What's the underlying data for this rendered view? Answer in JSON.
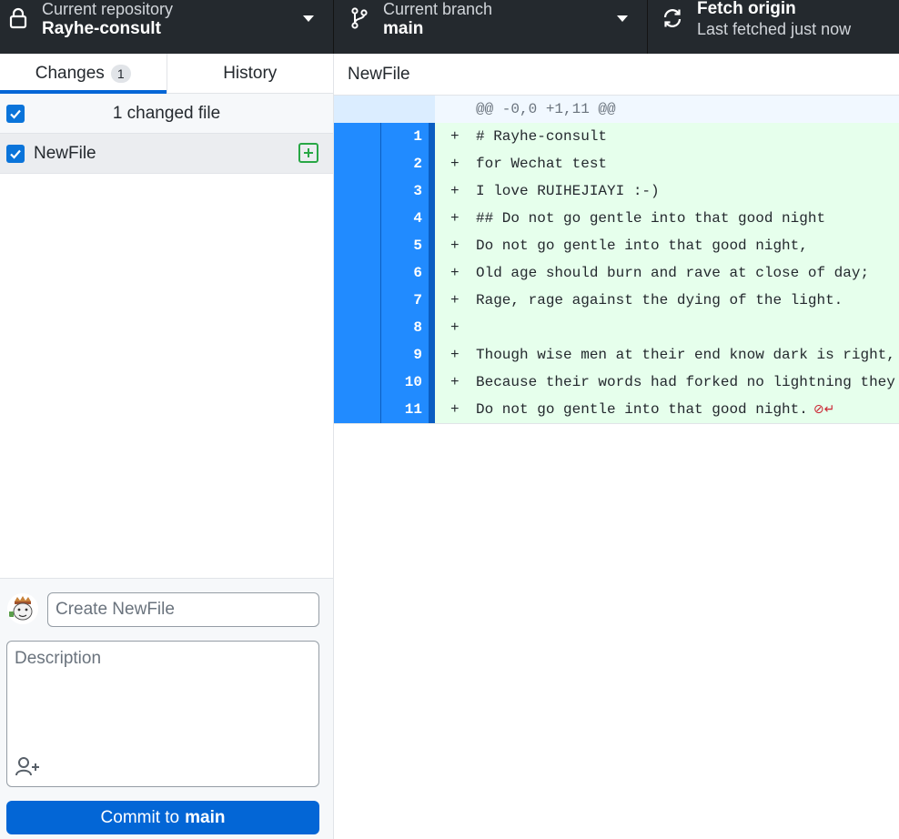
{
  "toolbar": {
    "repository": {
      "label": "Current repository",
      "value": "Rayhe-consult",
      "icon": "lock-icon"
    },
    "branch": {
      "label": "Current branch",
      "value": "main",
      "icon": "git-branch-icon"
    },
    "fetch": {
      "label": "Fetch origin",
      "status": "Last fetched just now",
      "icon": "sync-icon"
    }
  },
  "sidebar": {
    "tabs": [
      {
        "label": "Changes",
        "badge": "1",
        "selected": true
      },
      {
        "label": "History",
        "selected": false
      }
    ],
    "changes_header": {
      "label": "1 changed file",
      "checked": true
    },
    "files": [
      {
        "name": "NewFile",
        "checked": true,
        "status": "added"
      }
    ]
  },
  "commit": {
    "summary_placeholder": "Create NewFile",
    "description_placeholder": "Description",
    "button_prefix": "Commit to",
    "button_branch": "main"
  },
  "diff": {
    "file_title": "NewFile",
    "hunk_header": "@@ -0,0 +1,11 @@",
    "lines": [
      {
        "num": "1",
        "marker": "+",
        "text": "# Rayhe-consult"
      },
      {
        "num": "2",
        "marker": "+",
        "text": "for Wechat test"
      },
      {
        "num": "3",
        "marker": "+",
        "text": "I love RUIHEJIAYI :-)"
      },
      {
        "num": "4",
        "marker": "+",
        "text": "## Do not go gentle into that good night"
      },
      {
        "num": "5",
        "marker": "+",
        "text": "Do not go gentle into that good night,"
      },
      {
        "num": "6",
        "marker": "+",
        "text": "Old age should burn and rave at close of day;"
      },
      {
        "num": "7",
        "marker": "+",
        "text": "Rage, rage against the dying of the light."
      },
      {
        "num": "8",
        "marker": "+",
        "text": ""
      },
      {
        "num": "9",
        "marker": "+",
        "text": "Though wise men at their end know dark is right,"
      },
      {
        "num": "10",
        "marker": "+",
        "text": "Because their words had forked no lightning they"
      },
      {
        "num": "11",
        "marker": "+",
        "text": "Do not go gentle into that good night."
      }
    ],
    "no_newline_icon": "no-newline-at-eof-icon"
  },
  "colors": {
    "toolbar_bg": "#24292e",
    "accent": "#0366d6",
    "addition_bg": "#e6ffec",
    "line_number_selected": "#218bff",
    "added_icon": "#28a745",
    "no_newline": "#cb2431"
  }
}
